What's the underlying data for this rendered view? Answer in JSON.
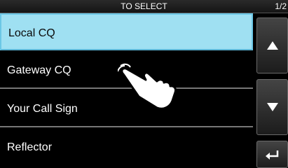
{
  "header": {
    "title": "TO SELECT",
    "page": "1/2"
  },
  "list": {
    "items": [
      {
        "label": "Local CQ",
        "selected": true
      },
      {
        "label": "Gateway CQ",
        "selected": false
      },
      {
        "label": "Your Call Sign",
        "selected": false
      },
      {
        "label": "Reflector",
        "selected": false
      }
    ]
  },
  "buttons": {
    "up_icon": "up-triangle-icon",
    "down_icon": "down-triangle-icon",
    "back_icon": "return-arrow-icon"
  },
  "colors": {
    "selected_bg": "#9fe0f2",
    "text": "#ffffff",
    "background": "#000000"
  }
}
